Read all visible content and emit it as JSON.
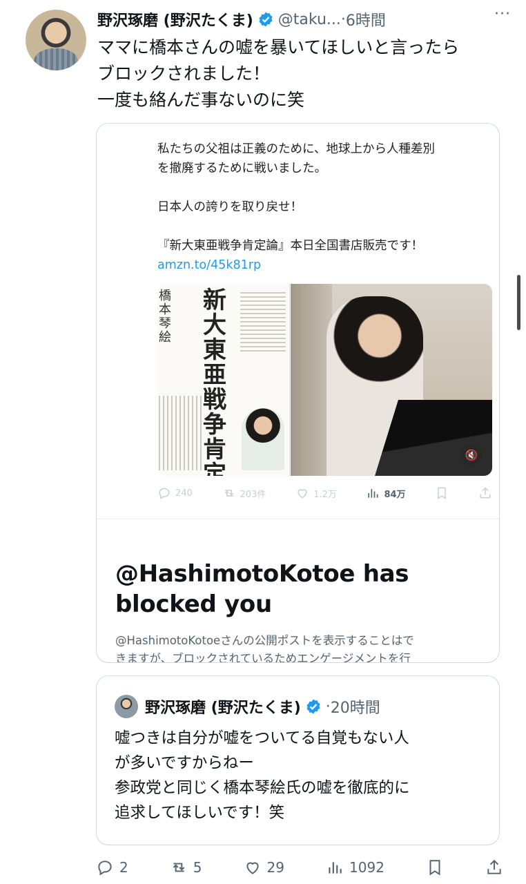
{
  "post": {
    "author_name": "野沢琢磨 (野沢たくま)",
    "handle": "@taku...",
    "separator": "·",
    "time": "6時間",
    "more": "···",
    "text_lines": [
      "ママに橋本さんの嘘を暴いてほしいと言ったら",
      "ブロックされました！",
      "一度も絡んだ事ないのに笑"
    ]
  },
  "quote": {
    "text_line_1": "私たちの父祖は正義のために、地球上から人種差別",
    "text_line_2": "を撤廃するために戦いました。",
    "text_line_3": "日本人の誇りを取り戻せ！",
    "text_line_4": "『新大東亜戦争肯定論』本日全国書店販売です！",
    "link": "amzn.to/45k81rp",
    "book_title": "新大東亜戦争肯定論",
    "book_author": "橋本琴絵",
    "mute_icon": "🔇",
    "inner_actions": {
      "replies": "240",
      "reposts": "203件",
      "likes": "1.2万",
      "views": "84万"
    },
    "blocked_title_line_1": "@HashimotoKotoe has",
    "blocked_title_line_2": "blocked you",
    "blocked_desc_line_1": "@HashimotoKotoeさんの公開ポストを表示することはで",
    "blocked_desc_line_2": "きますが、ブロックされているためエンゲージメントを行"
  },
  "quote2": {
    "author_name": "野沢琢磨 (野沢たくま)",
    "separator": "·",
    "time": "20時間",
    "text_lines": [
      "嘘つきは自分が嘘をついてる自覚もない人",
      "が多いですからねー",
      "参政党と同じく橋本琴絵氏の嘘を徹底的に",
      "追求してほしいです！笑"
    ]
  },
  "actions": {
    "replies": "2",
    "reposts": "5",
    "likes": "29",
    "views": "1092"
  },
  "colors": {
    "accent": "#1d9bf0",
    "text": "#0f1419",
    "muted": "#536471",
    "border": "#cfd9de"
  }
}
